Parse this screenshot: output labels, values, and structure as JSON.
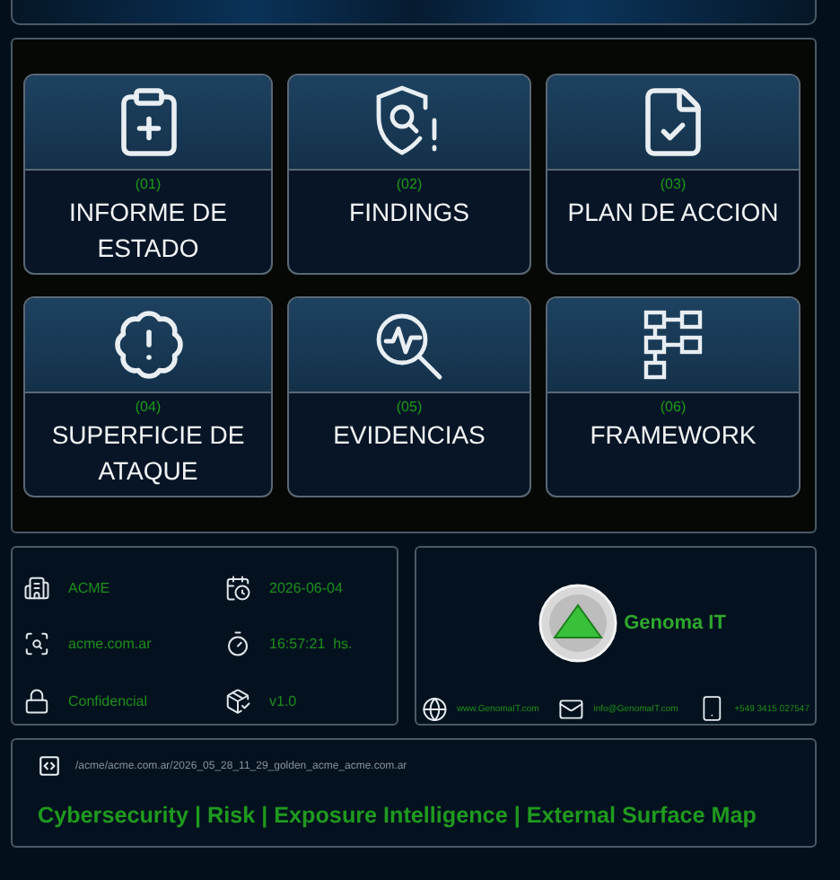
{
  "modules": [
    {
      "number": "(01)",
      "title": "INFORME DE ESTADO",
      "kind": "clipboard"
    },
    {
      "number": "(02)",
      "title": "FINDINGS",
      "kind": "shield"
    },
    {
      "number": "(03)",
      "title": "PLAN DE ACCION",
      "kind": "document"
    },
    {
      "number": "(04)",
      "title": "SUPERFICIE DE ATAQUE",
      "kind": "alert"
    },
    {
      "number": "(05)",
      "title": "EVIDENCIAS",
      "kind": "pulse"
    },
    {
      "number": "(06)",
      "title": "FRAMEWORK",
      "kind": "framework"
    }
  ],
  "details": [
    {
      "kind": "building",
      "value": "ACME"
    },
    {
      "kind": "calendar",
      "value": "2026-06-04"
    },
    {
      "kind": "scan",
      "value": "acme.com.ar"
    },
    {
      "kind": "clock",
      "value": "16:57:21  hs."
    },
    {
      "kind": "lock",
      "value": "Confidencial"
    },
    {
      "kind": "package",
      "value": "v1.0"
    }
  ],
  "company": {
    "name": "Genoma IT",
    "website": "www.GenomaIT.com",
    "email": "info@GenomaIT.com",
    "phone": "+549 3415 027547"
  },
  "footer": {
    "path": "/acme/acme.com.ar/2026_05_28_11_29_golden_acme_acme.com.ar",
    "tagline": "Cybersecurity | Risk | Exposure Intelligence | External Surface Map"
  }
}
